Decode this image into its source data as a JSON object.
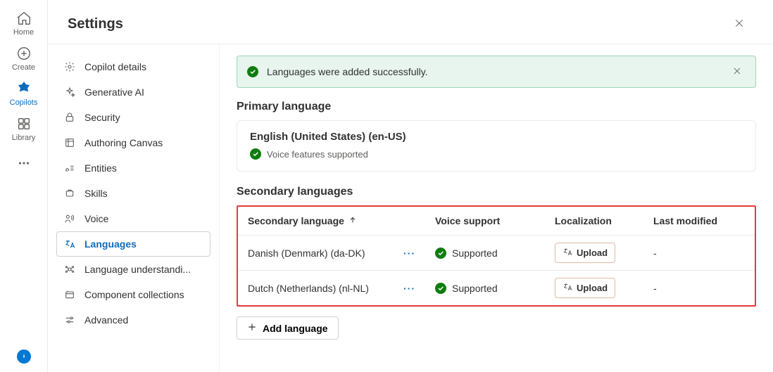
{
  "rail": {
    "home": "Home",
    "create": "Create",
    "copilots": "Copilots",
    "library": "Library"
  },
  "header": {
    "title": "Settings"
  },
  "sidebar": {
    "items": [
      {
        "label": "Copilot details"
      },
      {
        "label": "Generative AI"
      },
      {
        "label": "Security"
      },
      {
        "label": "Authoring Canvas"
      },
      {
        "label": "Entities"
      },
      {
        "label": "Skills"
      },
      {
        "label": "Voice"
      },
      {
        "label": "Languages"
      },
      {
        "label": "Language understandi..."
      },
      {
        "label": "Component collections"
      },
      {
        "label": "Advanced"
      }
    ]
  },
  "banner": {
    "text": "Languages were added successfully."
  },
  "primary": {
    "section_title": "Primary language",
    "name": "English (United States) (en-US)",
    "subtext": "Voice features supported"
  },
  "secondary": {
    "section_title": "Secondary languages",
    "columns": {
      "language": "Secondary language",
      "voice": "Voice support",
      "localization": "Localization",
      "modified": "Last modified"
    },
    "rows": [
      {
        "name": "Danish (Denmark) (da-DK)",
        "voice": "Supported",
        "upload": "Upload",
        "modified": "-"
      },
      {
        "name": "Dutch (Netherlands) (nl-NL)",
        "voice": "Supported",
        "upload": "Upload",
        "modified": "-"
      }
    ],
    "add_label": "Add language"
  }
}
